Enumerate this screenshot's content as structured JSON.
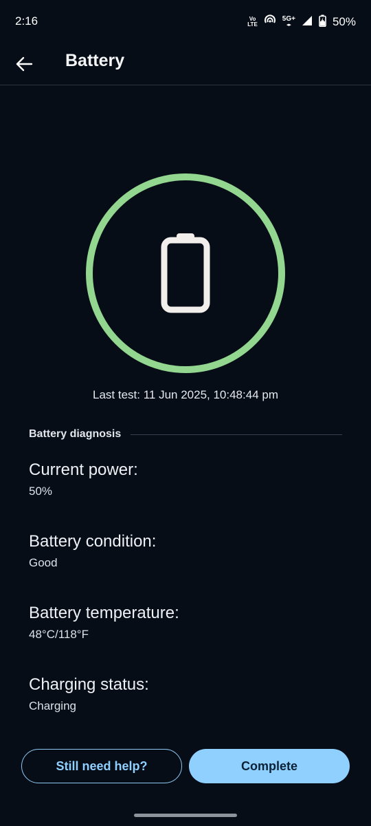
{
  "status_bar": {
    "time": "2:16",
    "volte_top": "Vo",
    "volte_bottom": "LTE",
    "network": "5G+",
    "battery": "50%"
  },
  "app_bar": {
    "title": "Battery"
  },
  "ring": {
    "color": "#93d690",
    "icon": "battery-outline-icon"
  },
  "last_test": "Last test: 11 Jun 2025, 10:48:44 pm",
  "diagnosis": {
    "title": "Battery diagnosis",
    "items": [
      {
        "label": "Current power:",
        "value": "50%"
      },
      {
        "label": "Battery condition:",
        "value": "Good"
      },
      {
        "label": "Battery temperature:",
        "value": "48°C/118°F"
      },
      {
        "label": "Charging status:",
        "value": "Charging"
      }
    ]
  },
  "buttons": {
    "help": "Still need help?",
    "complete": "Complete"
  },
  "colors": {
    "background": "#060d17",
    "accent": "#8fd0ff",
    "ring": "#93d690"
  }
}
